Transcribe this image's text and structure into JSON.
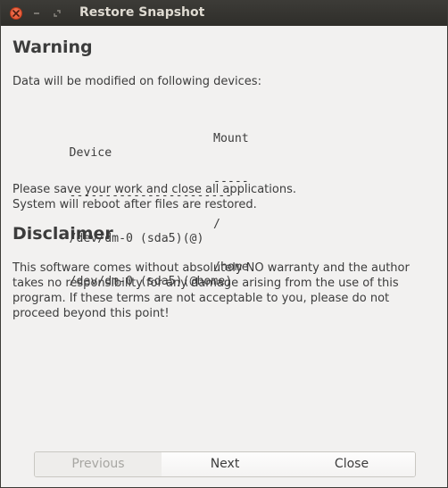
{
  "window": {
    "title": "Restore Snapshot"
  },
  "warning": {
    "heading": "Warning",
    "intro": "Data will be modified on following devices:",
    "table": {
      "headers": [
        "Device",
        "Mount"
      ],
      "separators": [
        "-----------------------",
        "-----"
      ],
      "rows": [
        [
          "/dev/dm-0 (sda5)(@)",
          "/"
        ],
        [
          "/dev/dm-0 (sda5)(@home)",
          "/home"
        ]
      ]
    },
    "notice_line1": "Please save your work and close all applications.",
    "notice_line2": "System will reboot after files are restored."
  },
  "disclaimer": {
    "heading": "Disclaimer",
    "lines": [
      "This software comes without absolutely NO warranty and the author",
      "takes no responsibility for any damage arising from the use of this",
      "program. If these terms are not acceptable to you, please do not",
      "proceed beyond this point!"
    ]
  },
  "buttons": {
    "previous": "Previous",
    "next": "Next",
    "close": "Close"
  },
  "icons": {
    "close": "close-icon",
    "minimize": "minimize-icon",
    "maximize": "maximize-icon"
  },
  "colors": {
    "titlebar": "#3c3b37",
    "close_button": "#e04f2b",
    "background": "#f2f1f0"
  }
}
